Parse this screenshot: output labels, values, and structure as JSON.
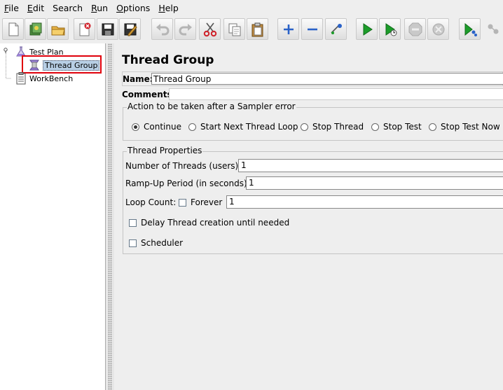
{
  "menu": [
    {
      "mnemonic": "F",
      "rest": "ile"
    },
    {
      "mnemonic": "E",
      "rest": "dit"
    },
    {
      "mnemonic": "",
      "rest": "Search"
    },
    {
      "mnemonic": "R",
      "rest": "un"
    },
    {
      "mnemonic": "O",
      "rest": "ptions"
    },
    {
      "mnemonic": "H",
      "rest": "elp"
    }
  ],
  "toolbar": {
    "icons": [
      "new-icon",
      "templates-icon",
      "open-icon",
      "close-icon",
      "save-icon",
      "save-as-icon",
      "undo-icon",
      "redo-icon",
      "cut-icon",
      "copy-icon",
      "paste-icon",
      "expand-icon",
      "collapse-icon",
      "toggle-icon",
      "start-icon",
      "start-no-pauses-icon",
      "stop-icon",
      "shutdown-icon",
      "remote-start-icon",
      "remote-icon"
    ]
  },
  "tree": {
    "test_plan": "Test Plan",
    "thread_group": "Thread Group",
    "workbench": "WorkBench"
  },
  "panel": {
    "title": "Thread Group",
    "name_label": "Name:",
    "name_value": "Thread Group",
    "comments_label": "Comments:",
    "comments_value": "",
    "error_action": {
      "legend": "Action to be taken after a Sampler error",
      "options": [
        "Continue",
        "Start Next Thread Loop",
        "Stop Thread",
        "Stop Test",
        "Stop Test Now"
      ],
      "selected": "Continue"
    },
    "thread_properties": {
      "legend": "Thread Properties",
      "threads_label": "Number of Threads (users):",
      "threads_value": "1",
      "rampup_label": "Ramp-Up Period (in seconds):",
      "rampup_value": "1",
      "loop_label": "Loop Count:",
      "forever_label": "Forever",
      "loop_value": "1",
      "delay_label": "Delay Thread creation until needed",
      "scheduler_label": "Scheduler"
    }
  },
  "colors": {
    "highlight": "#e0000b",
    "selection": "#b8cfe5",
    "play_green": "#1c9d2a",
    "cut_red": "#d0222b",
    "plus_blue": "#2a62c8"
  }
}
